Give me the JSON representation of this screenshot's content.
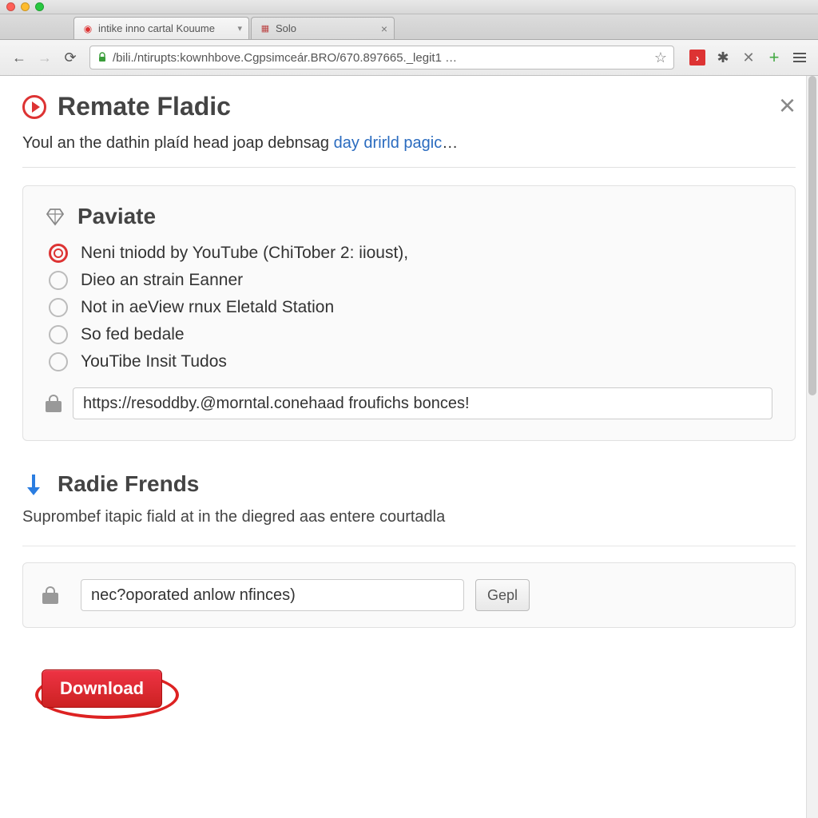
{
  "browser": {
    "tabs": [
      {
        "favicon": "●",
        "title": "intike inno cartal Kouume"
      },
      {
        "favicon": "■",
        "title": "Solo"
      }
    ],
    "url_display": "/bili./ntirupts:kownhbove.Cgpsimceár.BRO/670.897665._legit1 …",
    "extension_glyph": "›"
  },
  "page": {
    "title": "Remate Fladic",
    "intro_prefix": "Youl an the dathin plaíd head joap debnsag ",
    "intro_link": "day drirld pagic",
    "intro_suffix": "…"
  },
  "paviate": {
    "title": "Paviate",
    "options": [
      {
        "label": "Neni tniodd by YouTube (ChiTober 2: iioust),",
        "selected": true
      },
      {
        "label": "Dieo an strain Eanner",
        "selected": false
      },
      {
        "label": "Not in aeView rnux Eletald Station",
        "selected": false
      },
      {
        "label": "So fed bedale",
        "selected": false
      },
      {
        "label": "YouTibe Insit Tudos",
        "selected": false
      }
    ],
    "url_value": "https://resoddby.@morntal.conehaad froufichs bonces!"
  },
  "radie": {
    "title": "Radie Frends",
    "subtext": "Suprombef itapic fiald at in the diegred aas entere courtadla"
  },
  "search": {
    "value": "nec?oporated anlow nfinces)",
    "button_label": "Gepl"
  },
  "download_label": "Download"
}
